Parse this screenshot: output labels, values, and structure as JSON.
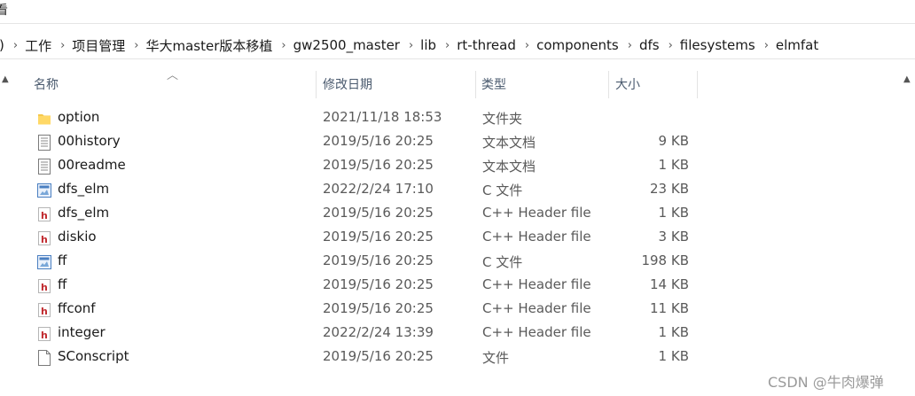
{
  "menu": {
    "view_label": "看"
  },
  "breadcrumb": {
    "lead": ")",
    "items": [
      "工作",
      "项目管理",
      "华大master版本移植",
      "gw2500_master",
      "lib",
      "rt-thread",
      "components",
      "dfs",
      "filesystems",
      "elmfat"
    ]
  },
  "columns": {
    "name": "名称",
    "date": "修改日期",
    "type": "类型",
    "size": "大小"
  },
  "files": [
    {
      "name": "option",
      "date": "2021/11/18 18:53",
      "type": "文件夹",
      "size": "",
      "icon": "folder-icon"
    },
    {
      "name": "00history",
      "date": "2019/5/16 20:25",
      "type": "文本文档",
      "size": "9 KB",
      "icon": "text-file-icon"
    },
    {
      "name": "00readme",
      "date": "2019/5/16 20:25",
      "type": "文本文档",
      "size": "1 KB",
      "icon": "text-file-icon"
    },
    {
      "name": "dfs_elm",
      "date": "2022/2/24 17:10",
      "type": "C 文件",
      "size": "23 KB",
      "icon": "c-file-icon"
    },
    {
      "name": "dfs_elm",
      "date": "2019/5/16 20:25",
      "type": "C++ Header file",
      "size": "1 KB",
      "icon": "header-file-icon"
    },
    {
      "name": "diskio",
      "date": "2019/5/16 20:25",
      "type": "C++ Header file",
      "size": "3 KB",
      "icon": "header-file-icon"
    },
    {
      "name": "ff",
      "date": "2019/5/16 20:25",
      "type": "C 文件",
      "size": "198 KB",
      "icon": "c-file-icon"
    },
    {
      "name": "ff",
      "date": "2019/5/16 20:25",
      "type": "C++ Header file",
      "size": "14 KB",
      "icon": "header-file-icon"
    },
    {
      "name": "ffconf",
      "date": "2019/5/16 20:25",
      "type": "C++ Header file",
      "size": "11 KB",
      "icon": "header-file-icon"
    },
    {
      "name": "integer",
      "date": "2022/2/24 13:39",
      "type": "C++ Header file",
      "size": "1 KB",
      "icon": "header-file-icon"
    },
    {
      "name": "SConscript",
      "date": "2019/5/16 20:25",
      "type": "文件",
      "size": "1 KB",
      "icon": "generic-file-icon"
    }
  ],
  "watermark": "CSDN @牛肉爆弹",
  "colors": {
    "folder": "#f5c84c",
    "header_red": "#c0282d",
    "c_blue": "#4a7fc1"
  }
}
